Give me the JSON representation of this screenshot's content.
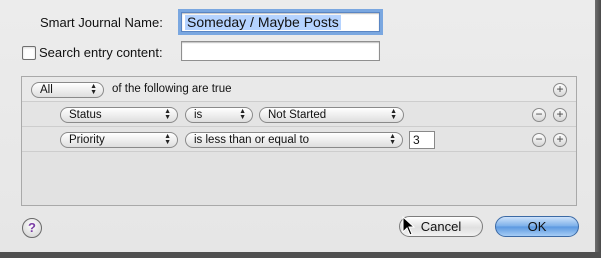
{
  "dialog": {
    "name_label": "Smart Journal Name:",
    "name_value": "Someday / Maybe Posts",
    "search_label": "Search entry content:",
    "search_value": ""
  },
  "rules": {
    "match_selector": "All",
    "match_suffix": "of the following are true",
    "rows": [
      {
        "field": "Status",
        "operator": "is",
        "value": "Not Started"
      },
      {
        "field": "Priority",
        "operator": "is less than or equal to",
        "value": "3"
      }
    ]
  },
  "buttons": {
    "help": "?",
    "cancel": "Cancel",
    "ok": "OK"
  }
}
